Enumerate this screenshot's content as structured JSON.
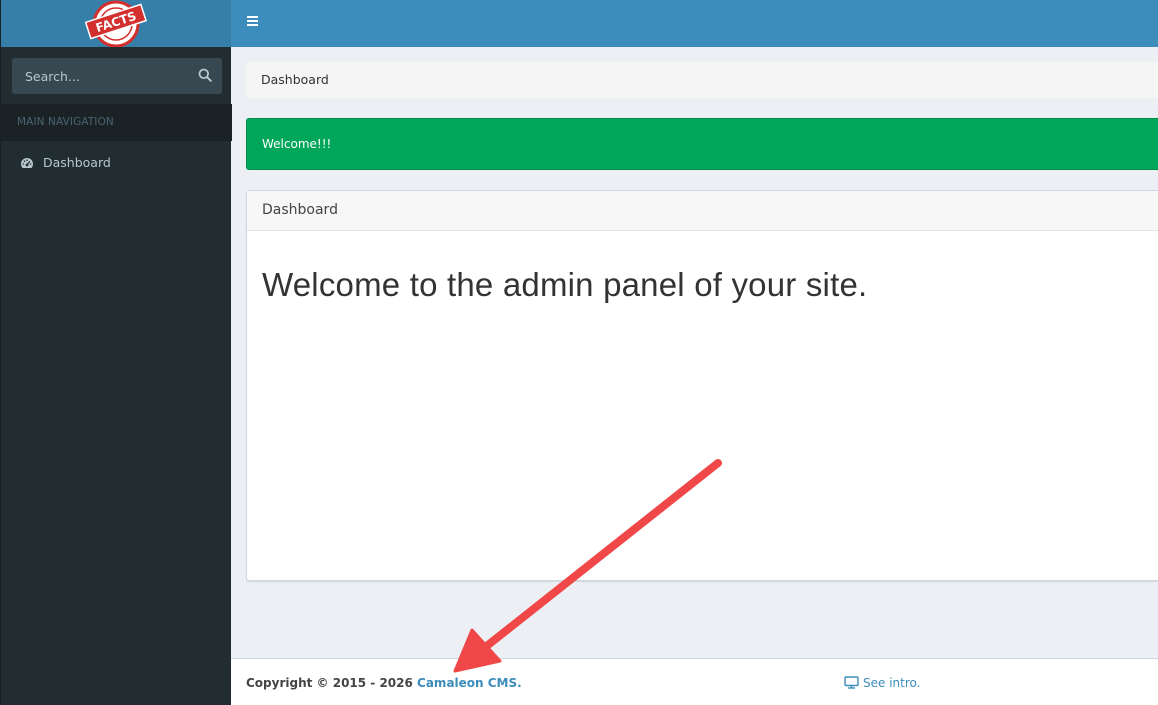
{
  "logo": {
    "text": "FACTS"
  },
  "search": {
    "placeholder": "Search..."
  },
  "sidebar": {
    "header": "MAIN NAVIGATION",
    "items": [
      {
        "label": "Dashboard",
        "icon": "dashboard-icon"
      }
    ]
  },
  "topbar": {
    "toggle_icon": "hamburger-icon"
  },
  "breadcrumb": {
    "label": "Dashboard"
  },
  "alert": {
    "message": "Welcome!!!"
  },
  "box": {
    "title": "Dashboard",
    "body": "Welcome to the admin panel of your site."
  },
  "footer": {
    "copyright": "Copyright © 2015 - 2026 ",
    "brand": "Camaleon CMS.",
    "intro": "See intro.",
    "intro_icon": "monitor-icon"
  },
  "colors": {
    "header_blue": "#3c8dbc",
    "sidebar_dark": "#222d32",
    "success_green": "#00a65a",
    "annotation_red": "#f04848"
  }
}
